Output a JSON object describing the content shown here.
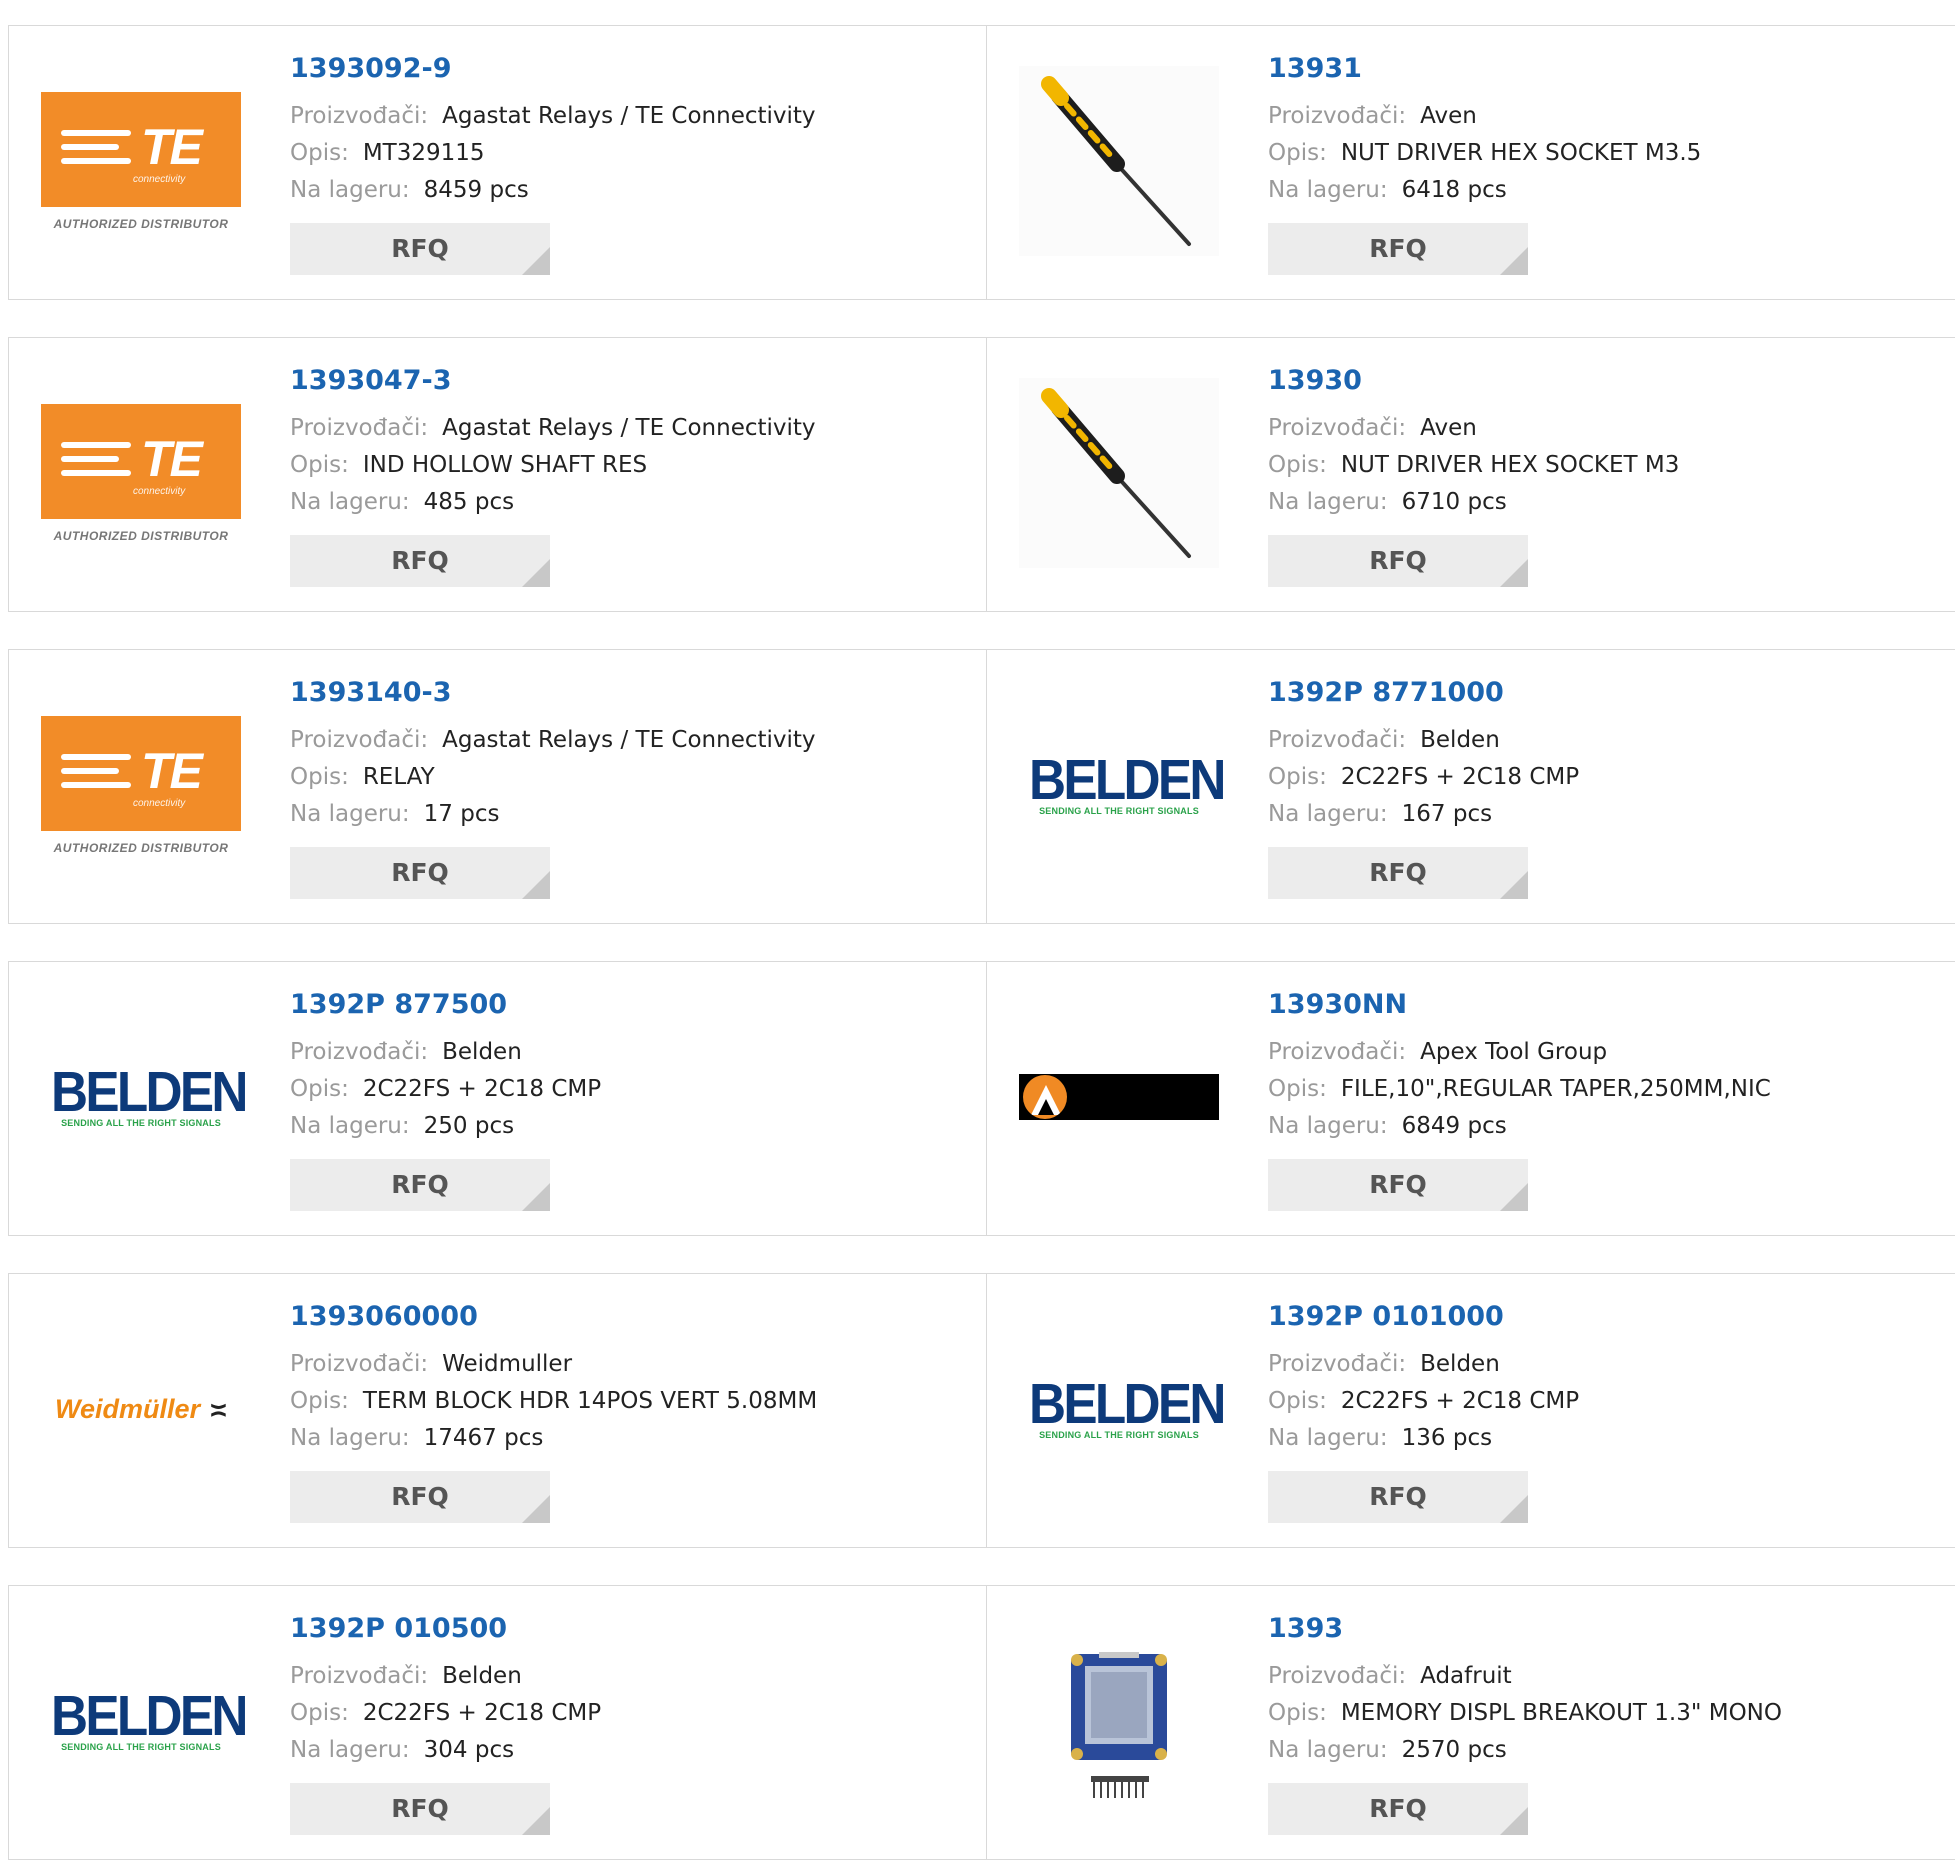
{
  "labels": {
    "manufacturer": "Proizvođači:",
    "description": "Opis:",
    "stock": "Na lageru:",
    "rfq": "RFQ"
  },
  "logo_text": {
    "te": "TE",
    "te_sub": "connectivity",
    "te_auth": "AUTHORIZED DISTRIBUTOR",
    "belden": "BELDEN",
    "belden_tag": "SENDING ALL THE RIGHT SIGNALS",
    "weidmuller": "Weidmüller"
  },
  "products": [
    {
      "part": "1393092-9",
      "manufacturer": "Agastat Relays / TE Connectivity",
      "description": "MT329115",
      "stock": "8459 pcs",
      "image": "te-logo"
    },
    {
      "part": "13931",
      "manufacturer": "Aven",
      "description": "NUT DRIVER HEX SOCKET M3.5",
      "stock": "6418 pcs",
      "image": "screwdriver-photo"
    },
    {
      "part": "1393047-3",
      "manufacturer": "Agastat Relays / TE Connectivity",
      "description": "IND HOLLOW SHAFT RES",
      "stock": "485 pcs",
      "image": "te-logo"
    },
    {
      "part": "13930",
      "manufacturer": "Aven",
      "description": "NUT DRIVER HEX SOCKET M3",
      "stock": "6710 pcs",
      "image": "screwdriver-photo"
    },
    {
      "part": "1393140-3",
      "manufacturer": "Agastat Relays / TE Connectivity",
      "description": "RELAY",
      "stock": "17 pcs",
      "image": "te-logo"
    },
    {
      "part": "1392P 8771000",
      "manufacturer": "Belden",
      "description": "2C22FS + 2C18 CMP",
      "stock": "167 pcs",
      "image": "belden-logo"
    },
    {
      "part": "1392P 877500",
      "manufacturer": "Belden",
      "description": "2C22FS + 2C18 CMP",
      "stock": "250 pcs",
      "image": "belden-logo"
    },
    {
      "part": "13930NN",
      "manufacturer": "Apex Tool Group",
      "description": "FILE,10\",REGULAR TAPER,250MM,NIC",
      "stock": "6849 pcs",
      "image": "apex-logo"
    },
    {
      "part": "1393060000",
      "manufacturer": "Weidmuller",
      "description": "TERM BLOCK HDR 14POS VERT 5.08MM",
      "stock": "17467 pcs",
      "image": "weidmuller-logo"
    },
    {
      "part": "1392P 0101000",
      "manufacturer": "Belden",
      "description": "2C22FS + 2C18 CMP",
      "stock": "136 pcs",
      "image": "belden-logo"
    },
    {
      "part": "1392P 010500",
      "manufacturer": "Belden",
      "description": "2C22FS + 2C18 CMP",
      "stock": "304 pcs",
      "image": "belden-logo"
    },
    {
      "part": "1393",
      "manufacturer": "Adafruit",
      "description": "MEMORY DISPL BREAKOUT 1.3\" MONO",
      "stock": "2570 pcs",
      "image": "display-board-photo"
    }
  ],
  "colors": {
    "part_link": "#1b64b0",
    "label": "#9a9a9a",
    "te_orange": "#f28c28",
    "belden_blue": "#0d3a7a",
    "belden_green": "#2aa24a",
    "weidmuller_orange": "#ef8a14",
    "rfq_bg": "#ececec"
  }
}
